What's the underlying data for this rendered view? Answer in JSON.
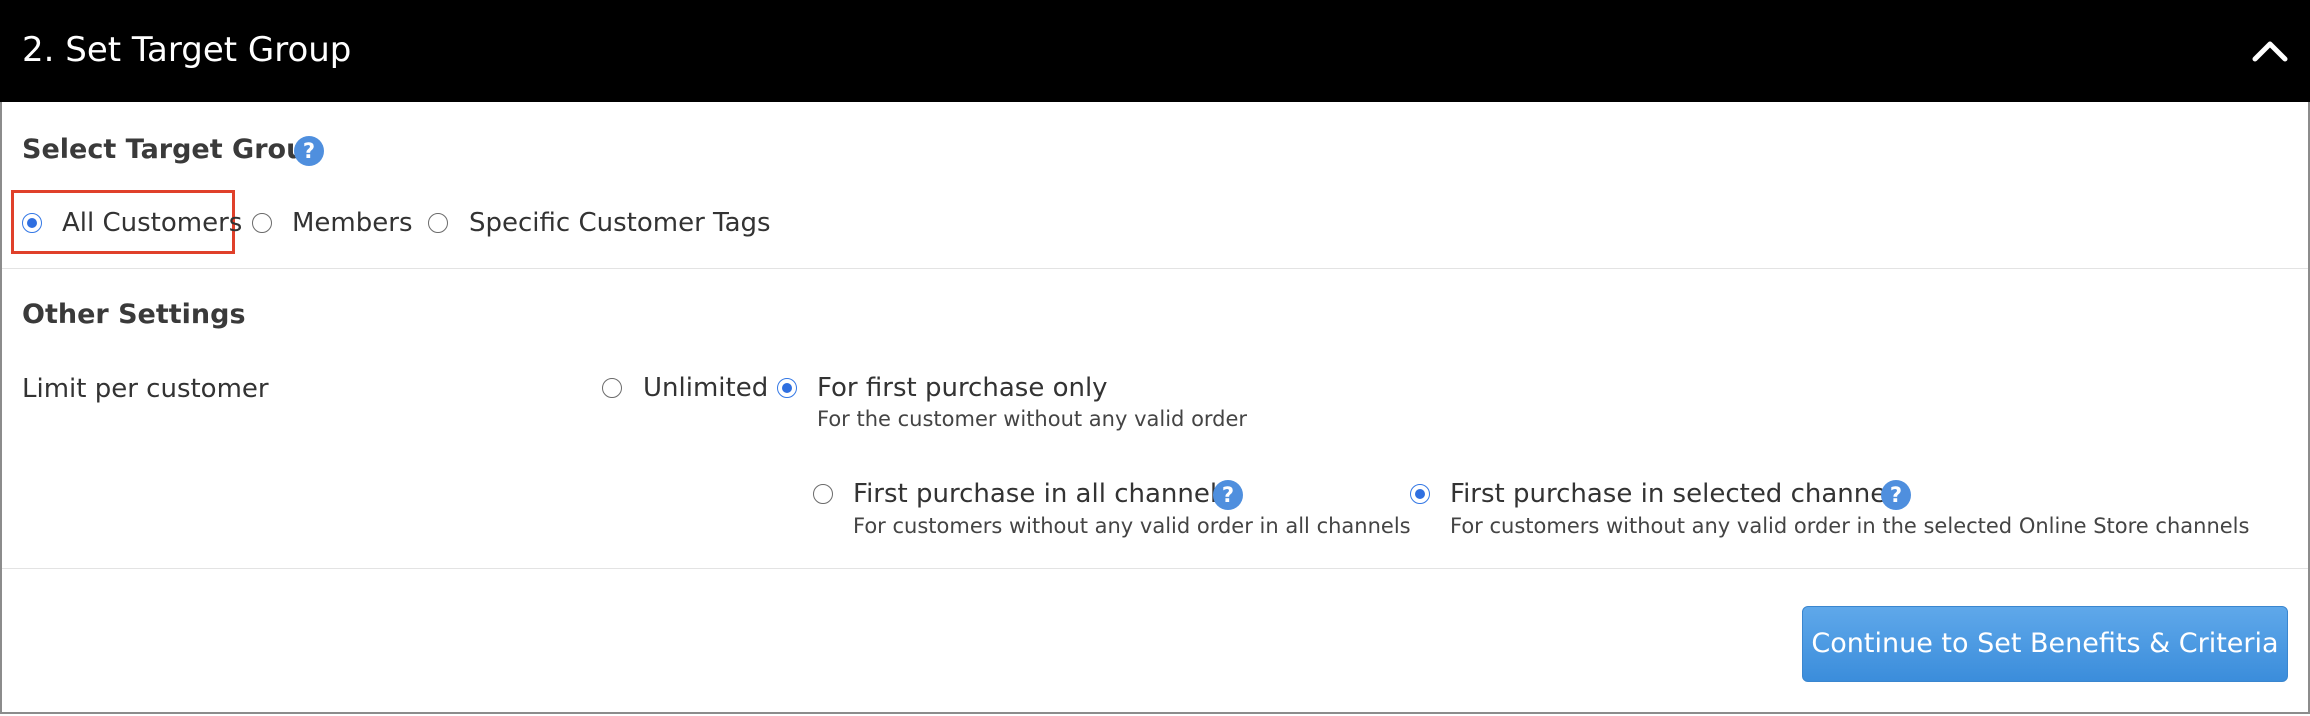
{
  "header": {
    "title": "2. Set Target Group",
    "collapse_icon": "chevron-up-icon"
  },
  "target_group": {
    "title": "Select Target Group",
    "help_icon": "question-icon",
    "options": [
      {
        "label": "All Customers",
        "selected": true
      },
      {
        "label": "Members",
        "selected": false
      },
      {
        "label": "Specific Customer Tags",
        "selected": false
      }
    ]
  },
  "other_settings": {
    "title": "Other Settings",
    "limit_label": "Limit per customer",
    "limit_options": [
      {
        "label": "Unlimited",
        "selected": false
      },
      {
        "label": "For first purchase only",
        "description": "For the customer without any valid order",
        "selected": true
      }
    ],
    "channel_options": [
      {
        "label": "First purchase in all channels",
        "description": "For customers without any valid order in all channels",
        "selected": false
      },
      {
        "label": "First purchase in selected channels",
        "description": "For customers without any valid order in the selected Online Store channels",
        "selected": true
      }
    ]
  },
  "actions": {
    "continue_label": "Continue to Set Benefits & Criteria"
  },
  "colors": {
    "header_bg": "#000000",
    "accent": "#3b8ddb",
    "highlight": "#e0402a",
    "help_icon": "#4f8fde"
  }
}
